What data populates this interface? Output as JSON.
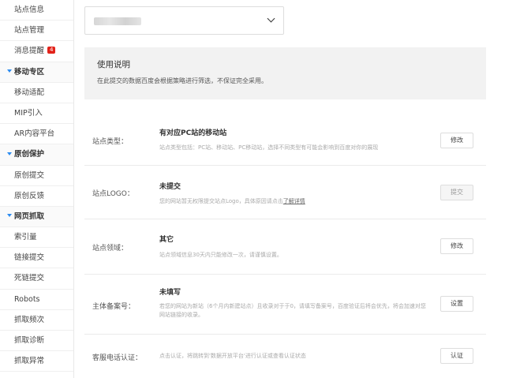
{
  "sidebar": {
    "items": [
      {
        "type": "item",
        "label": "站点信息"
      },
      {
        "type": "item",
        "label": "站点管理"
      },
      {
        "type": "item",
        "label": "消息提醒",
        "badge": "4"
      },
      {
        "type": "group",
        "label": "移动专区"
      },
      {
        "type": "item",
        "label": "移动适配"
      },
      {
        "type": "item",
        "label": "MIP引入"
      },
      {
        "type": "item",
        "label": "AR内容平台"
      },
      {
        "type": "group",
        "label": "原创保护"
      },
      {
        "type": "item",
        "label": "原创提交"
      },
      {
        "type": "item",
        "label": "原创反馈"
      },
      {
        "type": "group",
        "label": "网页抓取"
      },
      {
        "type": "item",
        "label": "索引量"
      },
      {
        "type": "item",
        "label": "链接提交"
      },
      {
        "type": "item",
        "label": "死链提交"
      },
      {
        "type": "item",
        "label": "Robots"
      },
      {
        "type": "item",
        "label": "抓取频次"
      },
      {
        "type": "item",
        "label": "抓取诊断"
      },
      {
        "type": "item",
        "label": "抓取异常"
      }
    ]
  },
  "notice": {
    "title": "使用说明",
    "text": "在此提交的数据百度会根据策略进行筛选，不保证完全采用。"
  },
  "rows": [
    {
      "label": "站点类型：",
      "value": "有对应PC站的移动站",
      "desc": "站点类型包括：PC站、移动站、PC移动站，选择不同类型有可能会影响到百度对你的展现",
      "button": "修改",
      "disabled": false
    },
    {
      "label": "站点LOGO：",
      "value": "未提交",
      "desc": "您的网站暂无权限提交站点Logo，具体原因请点击",
      "desc_link": "了解详情",
      "button": "提交",
      "disabled": true
    },
    {
      "label": "站点领域：",
      "value": "其它",
      "desc": "站点领域信息30天内只能修改一次，请谨慎设置。",
      "button": "修改",
      "disabled": false
    },
    {
      "label": "主体备案号：",
      "value": "未填写",
      "desc": "若您的网站为新站（6个月内新建站点）且收录对于于0，请填写备案号，百度验证后将会优先，将会加速对您网站链接的收录。",
      "button": "设置",
      "disabled": false
    },
    {
      "label": "客服电话认证：",
      "value": "",
      "desc": "点击认证，将跳转到'数据开放平台'进行认证或查看认证状态",
      "button": "认证",
      "disabled": false
    }
  ]
}
